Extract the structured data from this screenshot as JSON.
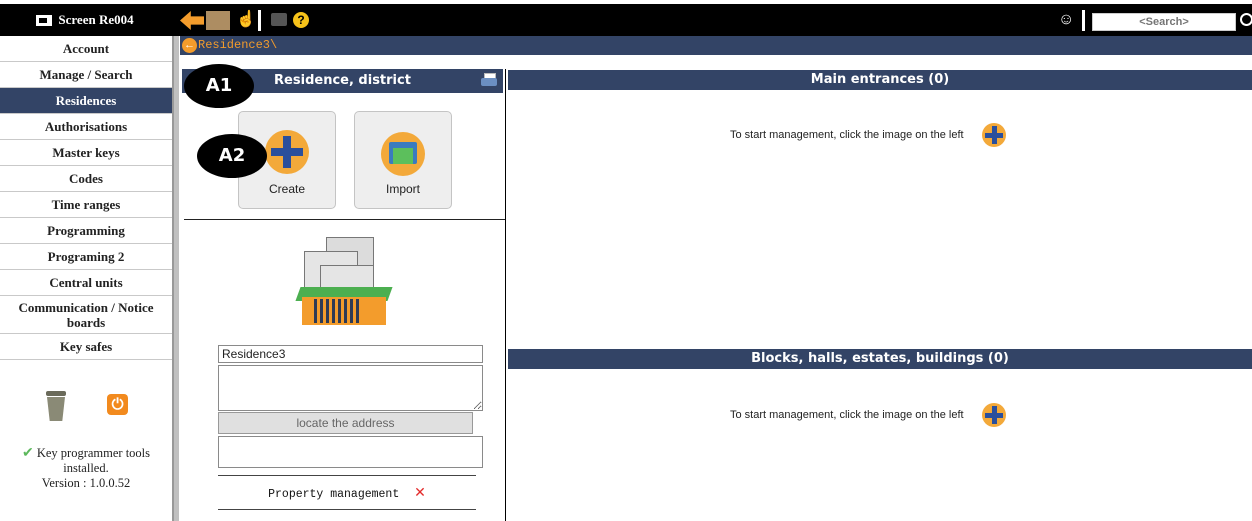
{
  "topbar": {
    "app_title": "Screen Re004",
    "search_placeholder": "<Search>",
    "icons": [
      "back-arrow-icon",
      "forward-arrow-icon",
      "hand-icon",
      "print-icon",
      "help-icon",
      "user-icon",
      "search-icon"
    ]
  },
  "sidebar": {
    "items": [
      {
        "label": "Account",
        "active": false
      },
      {
        "label": "Manage / Search",
        "active": false
      },
      {
        "label": "Residences",
        "active": true
      },
      {
        "label": "Authorisations",
        "active": false
      },
      {
        "label": "Master keys",
        "active": false
      },
      {
        "label": "Codes",
        "active": false
      },
      {
        "label": "Time ranges",
        "active": false
      },
      {
        "label": "Programming",
        "active": false
      },
      {
        "label": "Programing 2",
        "active": false
      },
      {
        "label": "Central units",
        "active": false
      },
      {
        "label": "Communication / Notice boards",
        "active": false
      },
      {
        "label": "Key safes",
        "active": false
      }
    ],
    "status_line1": "Key programmer tools installed.",
    "status_line2": "Version : 1.0.0.52"
  },
  "breadcrumb": {
    "text": "Residence3\\"
  },
  "left_panel": {
    "title": "Residence, district",
    "create_label": "Create",
    "import_label": "Import",
    "residence_name": "Residence3",
    "locate_label": "locate the address",
    "property_management": "Property management"
  },
  "right_panel": {
    "main_entrances_title": "Main entrances (0)",
    "blocks_title": "Blocks, halls, estates, buildings (0)",
    "hint": "To start management, click the image on the left"
  },
  "callouts": {
    "a1": "A1",
    "a2": "A2"
  },
  "colors": {
    "header_bg": "#334466",
    "accent_orange": "#f39c2c",
    "topbar_bg": "#000000"
  }
}
